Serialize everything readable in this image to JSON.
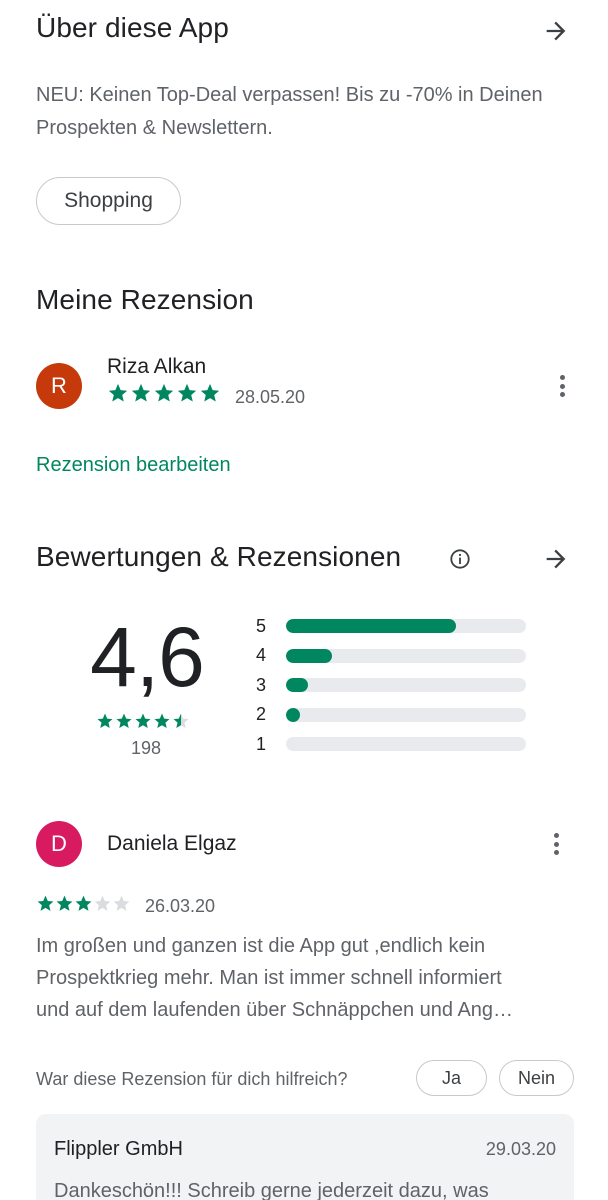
{
  "about": {
    "title": "Über diese App",
    "description": "NEU: Keinen Top-Deal verpassen! Bis zu -70% in Deinen Prospekten & Newslettern.",
    "chip": "Shopping"
  },
  "my_review": {
    "title": "Meine Rezension",
    "avatar_letter": "R",
    "avatar_color": "#c5390b",
    "name": "Riza Alkan",
    "stars": 5,
    "date": "28.05.20",
    "edit_link": "Rezension bearbeiten"
  },
  "ratings": {
    "title": "Bewertungen & Rezensionen",
    "score": "4,6",
    "stars": 4.5,
    "count": "198",
    "distribution": [
      {
        "label": "5",
        "fraction": 0.71
      },
      {
        "label": "4",
        "fraction": 0.19
      },
      {
        "label": "3",
        "fraction": 0.09
      },
      {
        "label": "2",
        "fraction": 0.06
      },
      {
        "label": "1",
        "fraction": 0.0
      }
    ],
    "accent": "#01875f"
  },
  "review": {
    "avatar_letter": "D",
    "avatar_color": "#d81b60",
    "name": "Daniela Elgaz",
    "stars": 3,
    "date": "26.03.20",
    "text_lines": [
      "Im großen und ganzen ist die App gut ,endlich kein",
      "Prospektkrieg mehr. Man ist immer schnell informiert",
      "und auf dem laufenden über Schnäppchen und Ang…"
    ],
    "helpful_question": "War diese Rezension für dich hilfreich?",
    "yes": "Ja",
    "no": "Nein"
  },
  "reply": {
    "name": "Flippler GmbH",
    "date": "29.03.20",
    "text": "Dankeschön!!! Schreib gerne jederzeit dazu, was"
  }
}
